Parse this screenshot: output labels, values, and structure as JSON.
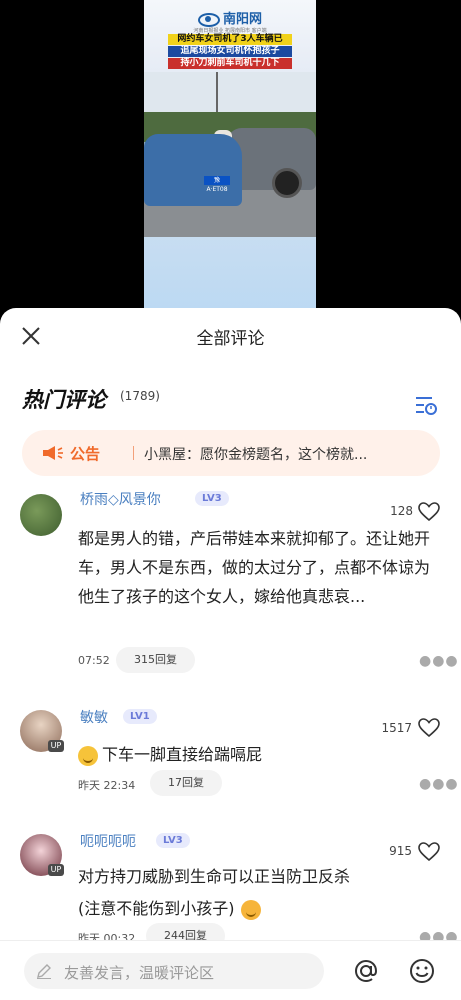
{
  "video": {
    "logo_text": "南阳网",
    "logo_sub": "河南日报报业  拓展南阳市 客户端",
    "headline_1": "网约车女司机了3人车辆已",
    "headline_2": "追尾现场女司机怀抱孩子",
    "headline_3": "持小刀刺前车司机十几下",
    "plate": "豫A·ET08"
  },
  "sheet": {
    "title": "全部评论",
    "hot_title": "热门评论",
    "hot_count": "(1789)"
  },
  "notice": {
    "label": "公告",
    "text": "小黑屋：愿你金榜题名，这个榜就..."
  },
  "comments": [
    {
      "name": "桥雨◇风景你",
      "level": "LV3",
      "likes": "128",
      "text": "都是男人的错，产后带娃本来就抑郁了。还让她开车，男人不是东西，做的太过分了，点都不体谅为他生了孩子的这个女人，嫁给他真悲哀...",
      "time": "07:52",
      "replies": "315回复"
    },
    {
      "name": "敏敏",
      "level": "LV1",
      "likes": "1517",
      "text": "下车一脚直接给踹嗝屁",
      "time": "昨天 22:34",
      "replies": "17回复",
      "badge": "UP"
    },
    {
      "name": "呃呃呃呃",
      "level": "LV3",
      "likes": "915",
      "text_1": "对方持刀威胁到生命可以正当防卫反杀",
      "text_2": "(注意不能伤到小孩子)",
      "time": "昨天 00:32",
      "replies": "244回复",
      "badge": "UP"
    }
  ],
  "bottom": {
    "placeholder": "友善发言，温暖评论区"
  },
  "colors": {
    "accent": "#f06a2b",
    "username": "#4a7fc0",
    "level_badge": "#6b7bd8"
  }
}
